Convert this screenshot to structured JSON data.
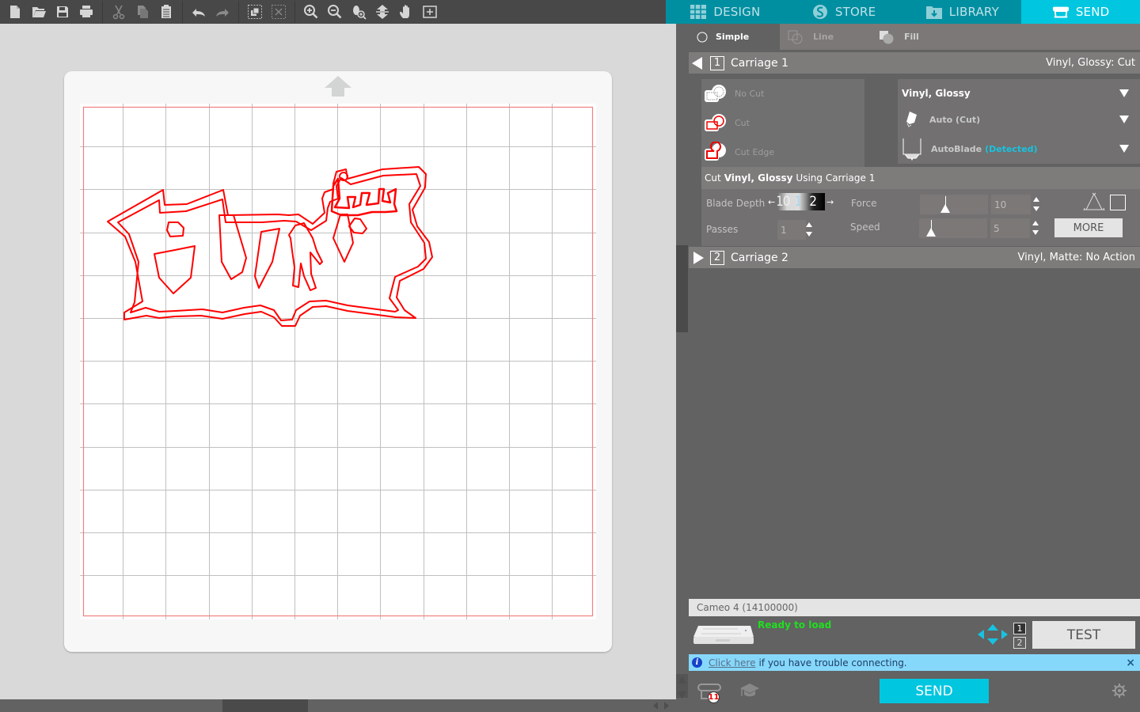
{
  "toolbar": {
    "buttons": [
      {
        "name": "new-file-icon"
      },
      {
        "name": "open-folder-icon"
      },
      {
        "name": "save-icon"
      },
      {
        "name": "print-icon"
      },
      {
        "name": "cut-scissors-icon"
      },
      {
        "name": "copy-icon"
      },
      {
        "name": "paste-clipboard-icon"
      },
      {
        "name": "undo-icon"
      },
      {
        "name": "redo-icon"
      },
      {
        "name": "group-icon"
      },
      {
        "name": "ungroup-icon"
      },
      {
        "name": "zoom-in-icon"
      },
      {
        "name": "zoom-out-icon"
      },
      {
        "name": "zoom-selection-icon"
      },
      {
        "name": "fit-to-page-icon"
      },
      {
        "name": "pan-hand-icon"
      },
      {
        "name": "zoom-fit-icon"
      }
    ]
  },
  "tabs": [
    {
      "label": "DESIGN",
      "icon": "grid-icon",
      "active": false
    },
    {
      "label": "STORE",
      "icon": "silhouette-s-icon",
      "active": false
    },
    {
      "label": "LIBRARY",
      "icon": "library-download-icon",
      "active": false
    },
    {
      "label": "SEND",
      "icon": "cutter-icon",
      "active": true
    }
  ],
  "modes": [
    {
      "label": "Simple",
      "active": true
    },
    {
      "label": "Line",
      "active": false
    },
    {
      "label": "Fill",
      "active": false
    }
  ],
  "carriage1": {
    "number": "1",
    "title": "Carriage 1",
    "status": "Vinyl, Glossy: Cut",
    "expanded": true,
    "actions": [
      {
        "label": "No Cut",
        "icon": "no-cut-icon"
      },
      {
        "label": "Cut",
        "icon": "cut-icon"
      },
      {
        "label": "Cut Edge",
        "icon": "cut-edge-icon"
      }
    ],
    "material": "Vinyl, Glossy",
    "tool": "Auto (Cut)",
    "blade": "AutoBlade",
    "blade_status": "(Detected)",
    "settings_title_prefix": "Cut",
    "settings_title_material": "Vinyl, Glossy",
    "settings_title_suffix": "Using Carriage 1",
    "blade_depth_label": "Blade Depth",
    "blade_depth_digits": [
      "10",
      "1",
      "2"
    ],
    "blade_depth_value": 1,
    "force_label": "Force",
    "force_value": "10",
    "force_fraction": 0.3,
    "passes_label": "Passes",
    "passes_value": "1",
    "speed_label": "Speed",
    "speed_value": "5",
    "speed_fraction": 0.1,
    "more_label": "MORE"
  },
  "carriage2": {
    "number": "2",
    "title": "Carriage 2",
    "status": "Vinyl, Matte: No Action",
    "expanded": false
  },
  "device": {
    "name": "Cameo 4 (14100000)",
    "status": "Ready to load",
    "carriage_select": [
      "1",
      "2"
    ],
    "test_label": "TEST"
  },
  "info_bar": {
    "link": "Click here",
    "text": "if you have trouble connecting.",
    "close": "×"
  },
  "send_label": "SEND",
  "library_badge": "11",
  "colors": {
    "accent": "#00c6e0",
    "tab_bar": "#008fa1",
    "cut_line": "#ff0000",
    "ready": "#1fe01f",
    "info_bg": "#86d8fb",
    "detected": "#17c3e0"
  }
}
